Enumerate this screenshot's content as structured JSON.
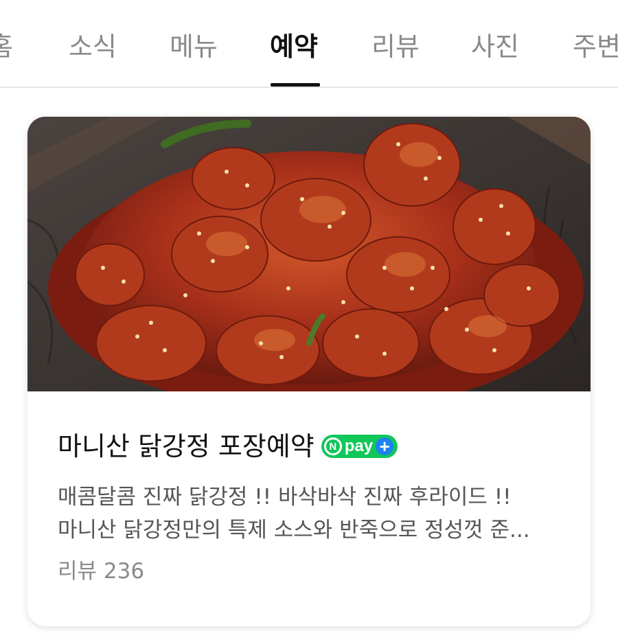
{
  "tabs": [
    {
      "label": "홈"
    },
    {
      "label": "소식"
    },
    {
      "label": "메뉴"
    },
    {
      "label": "예약"
    },
    {
      "label": "리뷰"
    },
    {
      "label": "사진"
    },
    {
      "label": "주변"
    }
  ],
  "active_tab": "예약",
  "card": {
    "title": "마니산 닭강정 포장예약",
    "badge": {
      "n": "N",
      "text": "pay",
      "plus": "+"
    },
    "description": "매콤달콤 진짜 닭강정 !! 바삭바삭 진짜 후라이드 !! 마니산 닭강정만의 특제 소스와 반죽으로 정성껏 준...",
    "review_label": "리뷰 236",
    "image_icon": "fried-chicken-photo"
  },
  "colors": {
    "active_tab": "#111111",
    "inactive_tab": "#8a8a8a",
    "npay_green": "#11c75a",
    "npay_blue": "#1b82f0"
  }
}
